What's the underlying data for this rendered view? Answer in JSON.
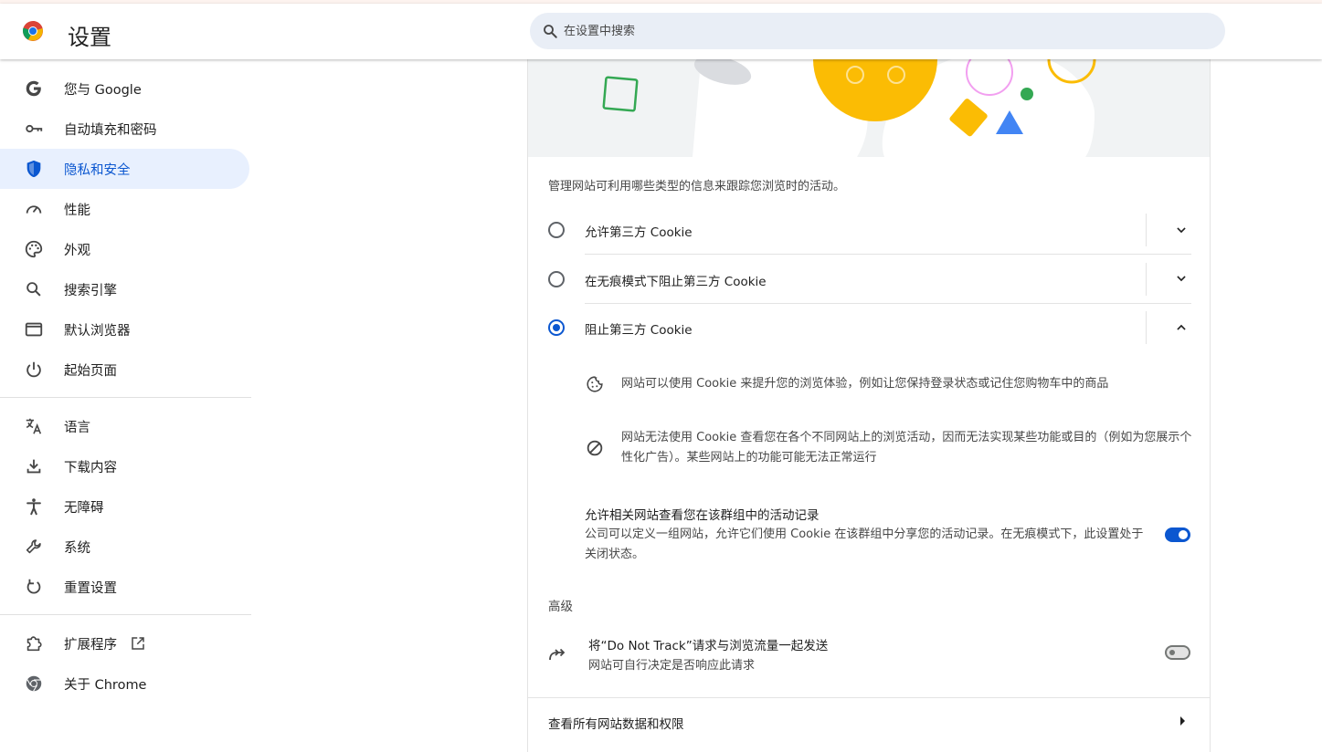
{
  "app": {
    "title": "设置"
  },
  "search": {
    "placeholder": "在设置中搜索"
  },
  "sidebar": {
    "items": [
      {
        "label": "您与 Google",
        "icon": "google-g-icon"
      },
      {
        "label": "自动填充和密码",
        "icon": "key-icon"
      },
      {
        "label": "隐私和安全",
        "icon": "shield-icon",
        "active": true
      },
      {
        "label": "性能",
        "icon": "speedometer-icon"
      },
      {
        "label": "外观",
        "icon": "palette-icon"
      },
      {
        "label": "搜索引擎",
        "icon": "search-icon"
      },
      {
        "label": "默认浏览器",
        "icon": "browser-window-icon"
      },
      {
        "label": "起始页面",
        "icon": "power-icon"
      },
      {
        "label": "语言",
        "icon": "translate-icon"
      },
      {
        "label": "下载内容",
        "icon": "download-icon"
      },
      {
        "label": "无障碍",
        "icon": "accessibility-icon"
      },
      {
        "label": "系统",
        "icon": "wrench-icon"
      },
      {
        "label": "重置设置",
        "icon": "reset-icon"
      },
      {
        "label": "扩展程序",
        "icon": "puzzle-icon"
      },
      {
        "label": "关于 Chrome",
        "icon": "chrome-icon"
      }
    ]
  },
  "cookies": {
    "description": "管理网站可利用哪些类型的信息来跟踪您浏览时的活动。",
    "options": [
      {
        "label": "允许第三方 Cookie",
        "selected": false,
        "expanded": false
      },
      {
        "label": "在无痕模式下阻止第三方 Cookie",
        "selected": false,
        "expanded": false
      },
      {
        "label": "阻止第三方 Cookie",
        "selected": true,
        "expanded": true
      }
    ],
    "details": [
      {
        "icon": "cookie-icon",
        "text": "网站可以使用 Cookie 来提升您的浏览体验，例如让您保持登录状态或记住您购物车中的商品"
      },
      {
        "icon": "block-icon",
        "text": "网站无法使用 Cookie 查看您在各个不同网站上的浏览活动，因而无法实现某些功能或目的（例如为您展示个性化广告）。某些网站上的功能可能无法正常运行"
      }
    ],
    "related_sites": {
      "title": "允许相关网站查看您在该群组中的活动记录",
      "description": "公司可以定义一组网站，允许它们使用 Cookie 在该群组中分享您的活动记录。在无痕模式下，此设置处于关闭状态。",
      "enabled": true
    }
  },
  "advanced": {
    "heading": "高级",
    "do_not_track": {
      "title": "将“Do Not Track”请求与浏览流量一起发送",
      "description": "网站可自行决定是否响应此请求",
      "enabled": false
    }
  },
  "site_data_link": {
    "label": "查看所有网站数据和权限"
  },
  "colors": {
    "accent": "#0b57d0",
    "active_nav_bg": "#e8f0fe"
  }
}
